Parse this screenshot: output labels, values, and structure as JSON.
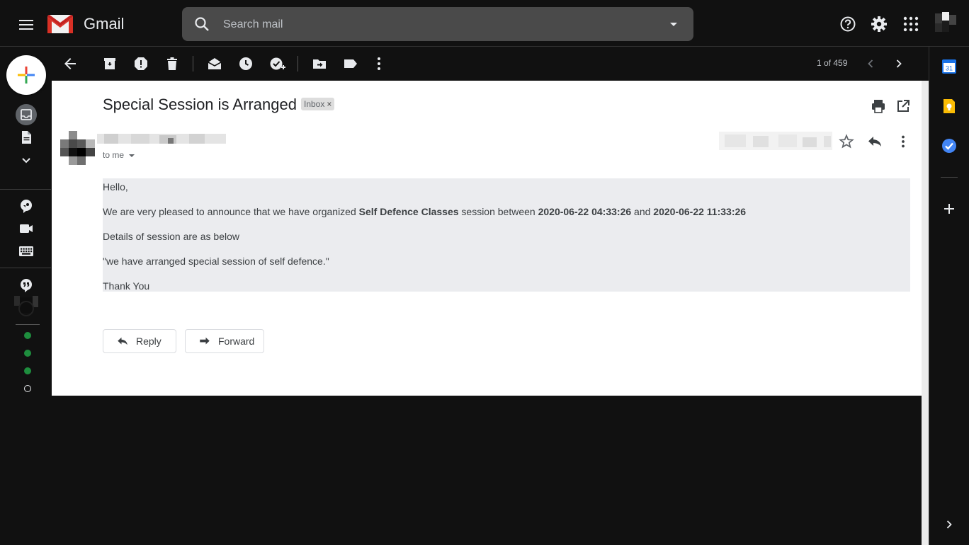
{
  "header": {
    "app_name": "Gmail",
    "search_placeholder": "Search mail"
  },
  "toolbar": {
    "pager": "1 of 459"
  },
  "email": {
    "subject": "Special Session is Arranged",
    "label_chip": "Inbox",
    "label_chip_close": "×",
    "recipient": "to me",
    "body": {
      "greeting": "Hello,",
      "announce_prefix": "We are very pleased to announce that we have organized ",
      "event_name": "Self Defence Classes",
      "announce_middle": " session between ",
      "start_time": "2020-06-22 04:33:26",
      "and_word": " and ",
      "end_time": "2020-06-22 11:33:26",
      "details_intro": "Details of session are as below",
      "details_quote": "\"we have arranged special session of self defence.\"",
      "closing": "Thank You"
    },
    "reply_label": "Reply",
    "forward_label": "Forward"
  },
  "side_panel": {
    "calendar_day": "31"
  },
  "colors": {
    "dark_bg": "#111111",
    "status_green": "#1e8e3e",
    "keep_yellow": "#fbbc04",
    "tasks_blue": "#4285f4"
  }
}
